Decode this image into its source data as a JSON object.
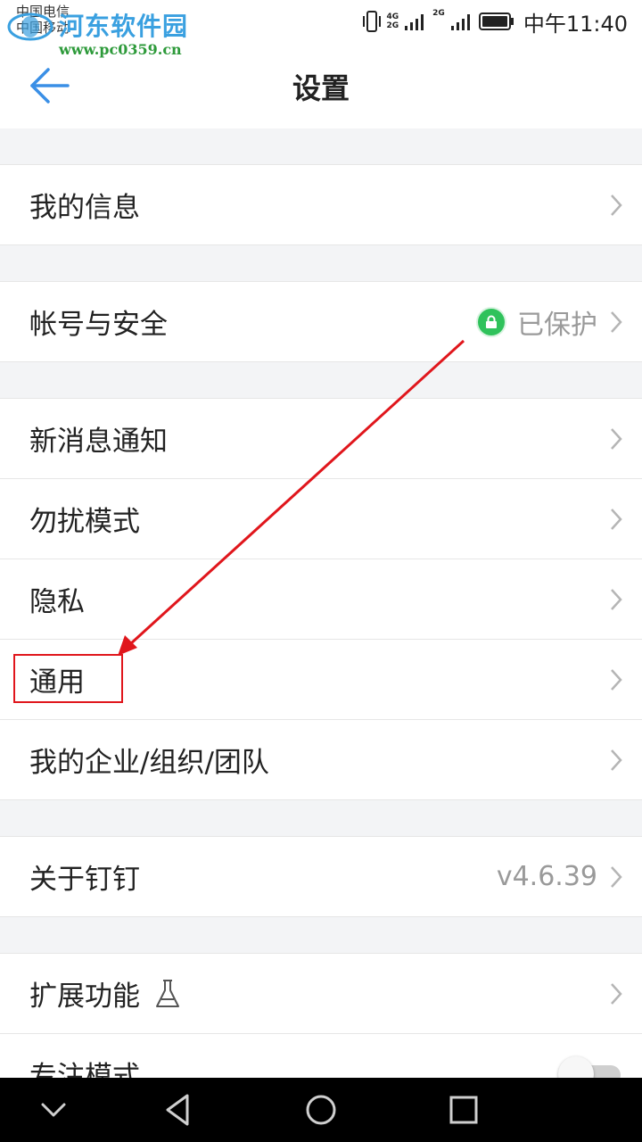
{
  "status_bar": {
    "carrier_1": "中国电信",
    "carrier_2": "中国移动",
    "network_1": "4G",
    "network_2": "2G",
    "network_3": "2G",
    "time": "中午11:40"
  },
  "watermark": {
    "title": "河东软件园",
    "url": "www.pc0359.cn"
  },
  "header": {
    "title": "设置"
  },
  "groups": [
    {
      "rows": [
        {
          "label": "我的信息"
        }
      ]
    },
    {
      "rows": [
        {
          "label": "帐号与安全",
          "value": "已保护"
        }
      ]
    },
    {
      "rows": [
        {
          "label": "新消息通知"
        },
        {
          "label": "勿扰模式"
        },
        {
          "label": "隐私"
        },
        {
          "label": "通用"
        },
        {
          "label": "我的企业/组织/团队"
        }
      ]
    },
    {
      "rows": [
        {
          "label": "关于钉钉",
          "value": "v4.6.39"
        }
      ]
    },
    {
      "rows": [
        {
          "label": "扩展功能"
        },
        {
          "label": "专注模式",
          "toggle": false
        }
      ]
    }
  ],
  "colors": {
    "accent": "#3a8fe6",
    "annotation": "#e0161c",
    "lock_green": "#2fc25b"
  }
}
